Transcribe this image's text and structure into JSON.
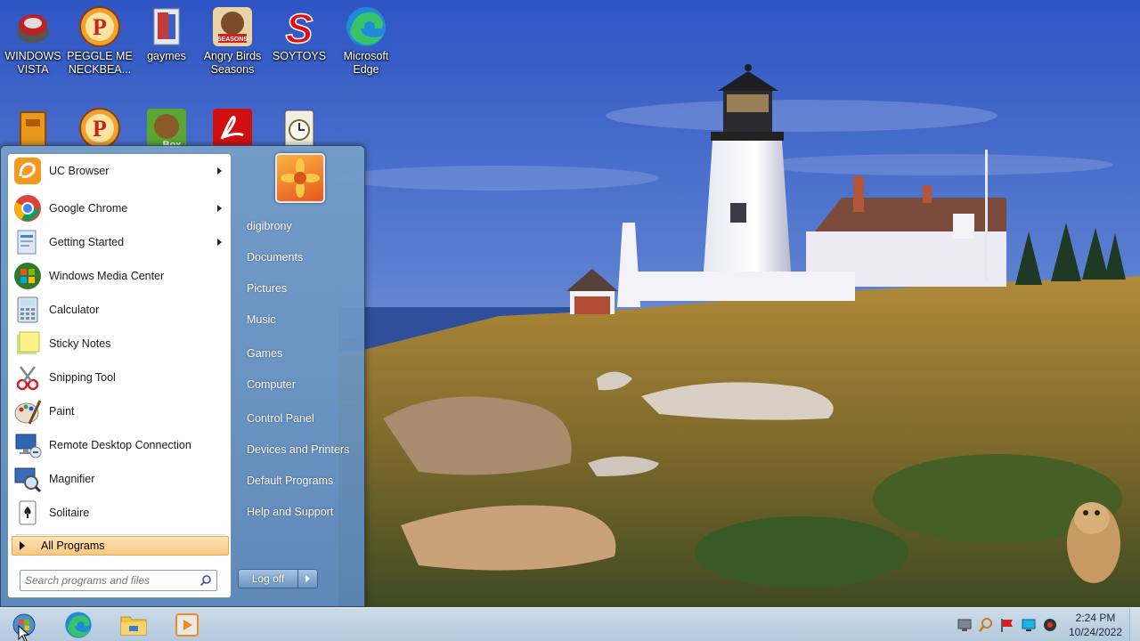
{
  "desktop": {
    "icons": [
      {
        "label": "WINDOWS VISTA",
        "icon": "windows-vista-icon"
      },
      {
        "label": "PEGGLE ME NECKBEA...",
        "icon": "peggle-icon"
      },
      {
        "label": "gaymes",
        "icon": "folder-icon"
      },
      {
        "label": "Angry Birds Seasons",
        "icon": "angry-birds-icon",
        "badge": "SEASONS"
      },
      {
        "label": "SOYTOYS",
        "icon": "red-s-icon",
        "glyph": "S"
      },
      {
        "label": "Microsoft Edge",
        "icon": "edge-icon"
      }
    ],
    "icons_row2": [
      {
        "icon": "blocks-icon"
      },
      {
        "icon": "peggle-icon"
      },
      {
        "icon": "beaver-box-icon",
        "badge": "Box"
      },
      {
        "icon": "adobe-reader-icon"
      },
      {
        "icon": "clock-app-icon"
      }
    ]
  },
  "start_menu": {
    "programs": [
      {
        "label": "UC Browser",
        "icon": "uc-browser-icon",
        "has_submenu": true
      },
      {
        "label": "Google Chrome",
        "icon": "chrome-icon",
        "has_submenu": true
      },
      {
        "label": "Getting Started",
        "icon": "getting-started-icon",
        "has_submenu": true
      },
      {
        "label": "Windows Media Center",
        "icon": "media-center-icon",
        "has_submenu": false
      },
      {
        "label": "Calculator",
        "icon": "calculator-icon",
        "has_submenu": false
      },
      {
        "label": "Sticky Notes",
        "icon": "sticky-notes-icon",
        "has_submenu": false
      },
      {
        "label": "Snipping Tool",
        "icon": "snipping-tool-icon",
        "has_submenu": false
      },
      {
        "label": "Paint",
        "icon": "paint-icon",
        "has_submenu": false
      },
      {
        "label": "Remote Desktop Connection",
        "icon": "remote-desktop-icon",
        "has_submenu": false
      },
      {
        "label": "Magnifier",
        "icon": "magnifier-icon",
        "has_submenu": false
      },
      {
        "label": "Solitaire",
        "icon": "solitaire-icon",
        "has_submenu": false
      }
    ],
    "all_programs_label": "All Programs",
    "search_placeholder": "Search programs and files",
    "places": [
      {
        "label": "digibrony"
      },
      {
        "label": "Documents"
      },
      {
        "label": "Pictures"
      },
      {
        "label": "Music"
      },
      {
        "label": "Games"
      },
      {
        "label": "Computer"
      },
      {
        "label": "Control Panel"
      },
      {
        "label": "Devices and Printers"
      },
      {
        "label": "Default Programs"
      },
      {
        "label": "Help and Support"
      }
    ],
    "logoff_label": "Log off"
  },
  "taskbar": {
    "pinned": [
      {
        "icon": "windows-orb-icon"
      },
      {
        "icon": "edge-icon"
      },
      {
        "icon": "file-explorer-icon"
      },
      {
        "icon": "media-player-icon"
      }
    ],
    "clock_time": "2:24 PM",
    "clock_date": "10/24/2022"
  },
  "colors": {
    "taskbar": "#c3d5e6",
    "start_menu_frame": "#6b95c4",
    "all_programs_highlight": "#f9d29a"
  }
}
